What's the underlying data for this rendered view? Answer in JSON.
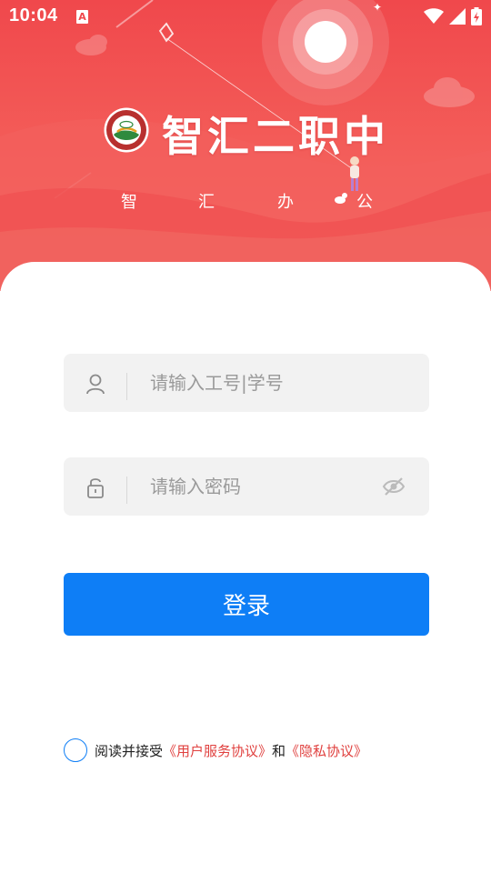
{
  "status_bar": {
    "time": "10:04",
    "notification_icon": "A"
  },
  "header": {
    "app_name": "智汇二职中",
    "subtitle_chars": [
      "智",
      "汇",
      "办",
      "公"
    ]
  },
  "form": {
    "username_placeholder": "请输入工号|学号",
    "password_placeholder": "请输入密码",
    "login_label": "登录"
  },
  "agreement": {
    "text": "阅读并接受",
    "user_agreement": "《用户服务协议》",
    "connector": "和",
    "privacy_policy": "《隐私协议》",
    "checked": false
  },
  "icons": {
    "user": "user-icon",
    "lock": "lock-icon",
    "eye": "eye-off-icon",
    "wifi": "wifi-icon",
    "signal": "signal-icon",
    "battery": "battery-icon"
  },
  "colors": {
    "header_red": "#f0484c",
    "primary_blue": "#0e7ef6",
    "link_red": "#e0413f",
    "input_bg": "#f2f2f2"
  }
}
